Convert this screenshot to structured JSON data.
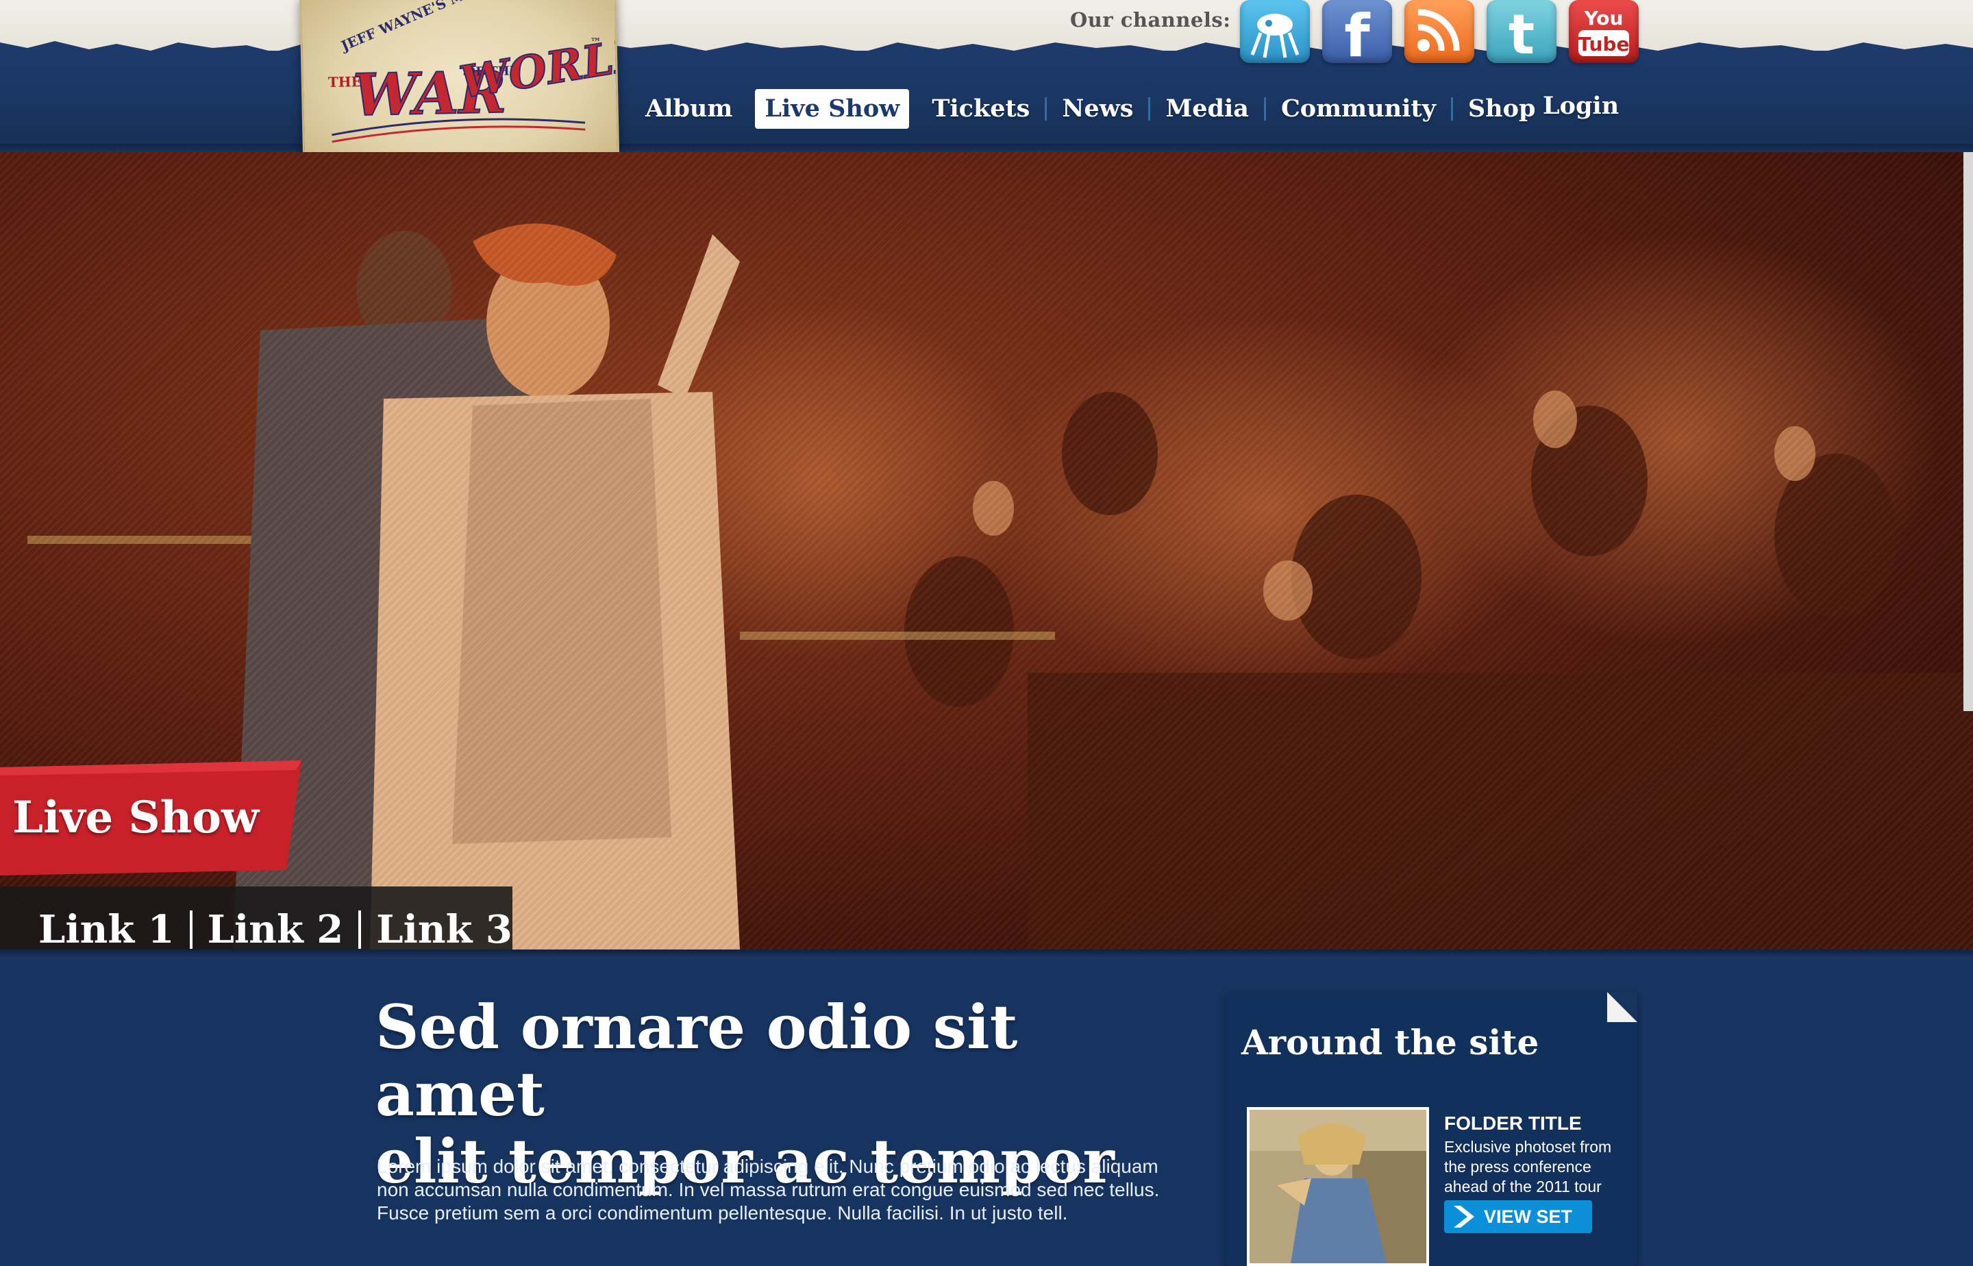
{
  "header": {
    "logo_text": {
      "top": "JEFF WAYNE'S MUSICAL VERSION OF",
      "the": "THE",
      "war": "WAR",
      "of_the": "OF THE",
      "worlds": "WORLDS",
      "tm": "™"
    },
    "channels_label": "Our channels:",
    "channels": [
      {
        "icon": "martian-icon",
        "color": "#3aa8d8"
      },
      {
        "icon": "facebook-icon",
        "color": "#3b66b4",
        "glyph": "f"
      },
      {
        "icon": "rss-icon",
        "color": "#f07a2a"
      },
      {
        "icon": "twitter-icon",
        "color": "#49b3c9",
        "glyph": "t"
      },
      {
        "icon": "youtube-icon",
        "color": "#d22a2a",
        "line1": "You",
        "line2": "Tube"
      }
    ],
    "nav": {
      "items": [
        "Album",
        "Live Show",
        "Tickets",
        "News",
        "Media",
        "Community",
        "Shop"
      ],
      "active": "Live Show"
    },
    "login_label": "Login"
  },
  "hero": {
    "section_label": "Live Show",
    "links": [
      "Link 1",
      "Link 2",
      "Link 3"
    ]
  },
  "main": {
    "headline_line1": "Sed ornare odio sit amet",
    "headline_line2": "elit tempor ac tempor",
    "body": "Lorem ipsum dolor sit amet, consectetur adipiscing elit. Nunc pretium odio ac lectus aliquam non accumsan nulla condimentum. In vel massa rutrum erat congue euismod sed nec tellus. Fusce pretium sem a orci condimentum pellentesque. Nulla facilisi. In ut justo tell."
  },
  "sidebar": {
    "title": "Around the site",
    "folder_title": "FOLDER TITLE",
    "folder_desc": "Exclusive photoset from the press conference ahead of the 2011 tour",
    "button_label": "VIEW SET"
  },
  "colors": {
    "navy": "#17335f",
    "accent_red": "#c8212a",
    "button_blue": "#0a8fd8"
  }
}
